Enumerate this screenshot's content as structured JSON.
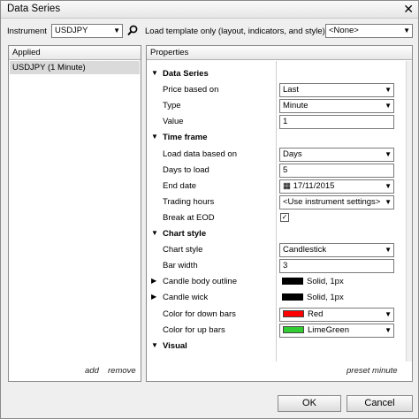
{
  "window": {
    "title": "Data Series",
    "close_glyph": "✕"
  },
  "instrument": {
    "label": "Instrument",
    "value": "USDJPY"
  },
  "template": {
    "label": "Load template only (layout, indicators, and style)",
    "value": "<None>"
  },
  "applied": {
    "header": "Applied",
    "items": [
      "USDJPY (1 Minute)"
    ],
    "add_label": "add",
    "remove_label": "remove"
  },
  "properties": {
    "header": "Properties",
    "preset_label": "preset minute",
    "rows": [
      {
        "name": "Data Series",
        "kind": "category"
      },
      {
        "name": "Price based on",
        "kind": "combo",
        "value": "Last"
      },
      {
        "name": "Type",
        "kind": "combo",
        "value": "Minute"
      },
      {
        "name": "Value",
        "kind": "text",
        "value": "1"
      },
      {
        "name": "Time frame",
        "kind": "category"
      },
      {
        "name": "Load data based on",
        "kind": "combo",
        "value": "Days"
      },
      {
        "name": "Days to load",
        "kind": "text",
        "value": "5"
      },
      {
        "name": "End date",
        "kind": "date",
        "value": "17/11/2015"
      },
      {
        "name": "Trading hours",
        "kind": "combo",
        "value": "<Use instrument settings>"
      },
      {
        "name": "Break at EOD",
        "kind": "check",
        "value": "✓"
      },
      {
        "name": "Chart style",
        "kind": "category"
      },
      {
        "name": "Chart style",
        "kind": "combo",
        "value": "Candlestick"
      },
      {
        "name": "Bar width",
        "kind": "text",
        "value": "3"
      },
      {
        "name": "Candle body outline",
        "kind": "stroke",
        "value": "Solid, 1px",
        "color": "#000000"
      },
      {
        "name": "Candle wick",
        "kind": "stroke",
        "value": "Solid, 1px",
        "color": "#000000"
      },
      {
        "name": "Color for down bars",
        "kind": "color",
        "value": "Red",
        "color": "#ff0000"
      },
      {
        "name": "Color for up bars",
        "kind": "color",
        "value": "LimeGreen",
        "color": "#32cd32"
      },
      {
        "name": "Visual",
        "kind": "category"
      }
    ]
  },
  "buttons": {
    "ok": "OK",
    "cancel": "Cancel"
  }
}
